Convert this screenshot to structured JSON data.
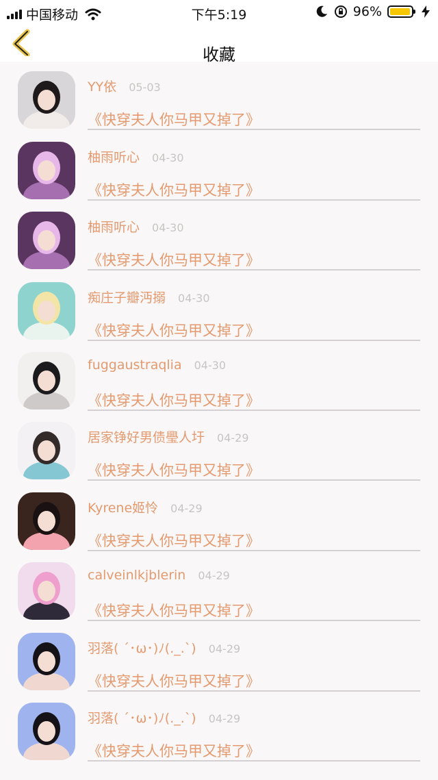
{
  "status_bar": {
    "carrier": "中国移动",
    "time": "下午5:19",
    "battery_percent": "96%",
    "battery_level": 0.96
  },
  "nav": {
    "title": "收藏",
    "back_icon": "chevron-left-icon"
  },
  "colors": {
    "accent": "#e49a6e",
    "back_chevron": "#e7c34a",
    "date": "#c8c4c4",
    "background": "#faf7f8"
  },
  "favorites": [
    {
      "name": "",
      "date": "",
      "book": "《快穿夫人你马甲又掉了》",
      "avatar": "avatar-girl-white"
    },
    {
      "name": "YY依",
      "date": "05-03",
      "book": "《快穿夫人你马甲又掉了》",
      "avatar": "avatar-girl-braids"
    },
    {
      "name": "柚雨听心",
      "date": "04-30",
      "book": "《快穿夫人你马甲又掉了》",
      "avatar": "avatar-purple-art"
    },
    {
      "name": "柚雨听心",
      "date": "04-30",
      "book": "《快穿夫人你马甲又掉了》",
      "avatar": "avatar-purple-art"
    },
    {
      "name": "痴庄子瓣沔搦",
      "date": "04-30",
      "book": "《快穿夫人你马甲又掉了》",
      "avatar": "avatar-anime-teal"
    },
    {
      "name": "fuggaustraqlia",
      "date": "04-30",
      "book": "《快穿夫人你马甲又掉了》",
      "avatar": "avatar-girl-phone"
    },
    {
      "name": "居家铮好男债璺人圩",
      "date": "04-29",
      "book": "《快穿夫人你马甲又掉了》",
      "avatar": "avatar-couple"
    },
    {
      "name": "Kyrene姬怜",
      "date": "04-29",
      "book": "《快穿夫人你马甲又掉了》",
      "avatar": "avatar-man-pink"
    },
    {
      "name": "calveinlkjblerin",
      "date": "04-29",
      "book": "《快穿夫人你马甲又掉了》",
      "avatar": "avatar-anime-pink"
    },
    {
      "name": "羽落( ´･ω･)ﾉ(._.`)",
      "date": "04-29",
      "book": "《快穿夫人你马甲又掉了》",
      "avatar": "avatar-anime-dark"
    },
    {
      "name": "羽落( ´･ω･)ﾉ(._.`)",
      "date": "04-29",
      "book": "《快穿夫人你马甲又掉了》",
      "avatar": "avatar-anime-dark"
    }
  ]
}
